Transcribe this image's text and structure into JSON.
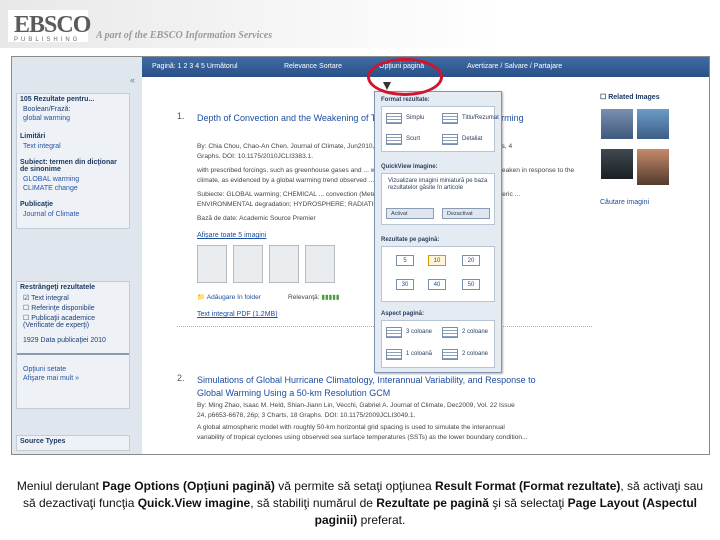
{
  "logo": {
    "name": "EBSCO",
    "sub": "PUBLISHING",
    "tagline": "A part of the EBSCO Information Services"
  },
  "topbar": {
    "pages": "Pagină: 1 2 3 4 5 Următorul",
    "relevance": "Relevance Sortare",
    "page_options": "Opţiuni pagină",
    "share": "Avertizare / Salvare / Partajare"
  },
  "sidebar": {
    "results_count": "105 Rezultate pentru...",
    "query1": "Boolean/Frază:",
    "query2": "global warming",
    "limit_head": "Limitări",
    "limit_item": "Text integral",
    "subject_head": "Subiect: termen din dicţionar de sinonime",
    "subject_item1": "GLOBAL warming",
    "subject_item2": "CLIMATE change",
    "publisher_head": "Publicaţie",
    "publisher_item": "Journal of Climate",
    "refine_head": "Restrângeţi rezultatele",
    "refine1": "Text integral",
    "refine2": "Referinţe disponibile",
    "refine3": "Publicaţii academice (Verificate de experţi)",
    "date_label": "Data publicaţiei",
    "date_from": "1929",
    "date_to": "2010",
    "more": "Afişare mai mult »",
    "options": "Opţiuni setate",
    "source_types": "Source Types"
  },
  "results": [
    {
      "num": "1.",
      "title": "Depth of Convection and the Weakening of Tropical Circulation in Global Warming",
      "byline": "By: Chia Chou, Chao-An Chen. Journal of Climate, Jun2010, Vol. 23 Issue 11, p3019-3030. 12p. 4 Charts, 4",
      "meta": "Graphs. DOI: 10.1175/2010JCLI3383.1.",
      "abs1": "with prescribed forcings, such as greenhouse gases and ... warming, the tropical circulation is found to weaken in response to the",
      "abs2": "climate, as evidenced by a global warming trend observed ...",
      "subjects1": "Subiecte: GLOBAL warming; CHEMICAL ... convection (Meteorology); ... Tropical circulation; ... Atmospheric ...",
      "subjects2": "ENVIRONMENTAL degradation; HYDROSPHERE; RADIATION ... EFFECT of",
      "db": "Bază de date: Academic Source Premier",
      "images": "Afişare toate 5 imagini",
      "folder": "Adăugare în folder",
      "relevance": "Relevanţă:",
      "pdf": "Text integral PDF (1.2MB)"
    },
    {
      "num": "2.",
      "title": "Simulations of Global Hurricane Climatology, Interannual Variability, and Response to",
      "title2": "Global Warming Using a 50-km Resolution GCM",
      "byline": "By: Ming Zhao, Isaac M. Held, Shian-Jiann Lin, Vecchi, Gabriel A. Journal of Climate, Dec2009, Vol. 22 Issue",
      "meta": "24, p6653-6678, 26p; 3 Charts, 18 Graphs. DOI: 10.1175/2009JCLI3049.1.",
      "abs1": "A global atmospheric model with roughly 50-km horizontal grid spacing is used to simulate the interannual",
      "abs2": "variability of tropical cyclones using observed sea surface temperatures (SSTs) as the lower boundary condition..."
    }
  ],
  "right": {
    "related": "Related Images",
    "more": "Căutare imagini"
  },
  "dropdown": {
    "format_head": "Format rezultate:",
    "opt_simple": "Simplu",
    "opt_short": "Titlu/Rezumat",
    "opt_standard": "Scurt",
    "opt_detailed": "Detaliat",
    "quickview_head": "QuickView imagine:",
    "quickview_text": "Vizualizare imagini miniatură pe baza rezultatelor găsite în articole",
    "quickview_on": "Activat",
    "quickview_off": "Dezactivat",
    "perpage_head": "Rezultate pe pagină:",
    "perpage": [
      "5",
      "10",
      "20",
      "30",
      "40",
      "50"
    ],
    "layout_head": "Aspect pagină:",
    "layout1": "3 coloane",
    "layout2": "2 coloane",
    "layout3": "1 coloană",
    "layout4": "2 coloane"
  },
  "caption": {
    "p1": "Meniul derulant ",
    "b1": "Page Options (Opţiuni pagină)",
    "p2": " vă permite să setaţi opţiunea ",
    "b2": "Result Format (Format rezultate)",
    "p3": ", să activaţi sau să dezactivaţi funcţia ",
    "b3": "Quick.View imagine",
    "p4": ", să stabiliţi numărul de ",
    "b4": "Rezultate pe pagină",
    "p5": " şi să selectaţi ",
    "b5": "Page Layout (Aspectul paginii)",
    "p6": " preferat."
  },
  "colors": {
    "accent_blue": "#2a5087",
    "highlight_red": "#d0142c",
    "link": "#1d4ea0"
  }
}
